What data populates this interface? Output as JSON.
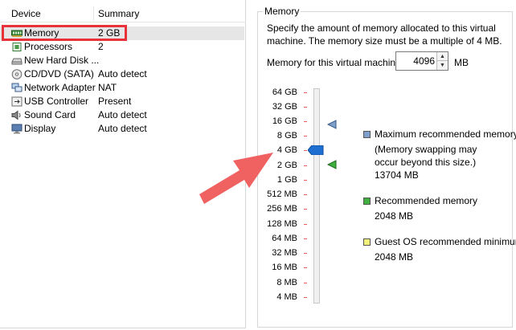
{
  "device_list": {
    "headers": {
      "device": "Device",
      "summary": "Summary"
    },
    "rows": [
      {
        "icon": "memory-chip-icon",
        "name": "Memory",
        "summary": "2 GB",
        "selected": true
      },
      {
        "icon": "processor-icon",
        "name": "Processors",
        "summary": "2"
      },
      {
        "icon": "hard-disk-icon",
        "name": "New Hard Disk ...",
        "summary": ""
      },
      {
        "icon": "cd-dvd-icon",
        "name": "CD/DVD (SATA)",
        "summary": "Auto detect"
      },
      {
        "icon": "network-adapter-icon",
        "name": "Network Adapter",
        "summary": "NAT"
      },
      {
        "icon": "usb-controller-icon",
        "name": "USB Controller",
        "summary": "Present"
      },
      {
        "icon": "sound-card-icon",
        "name": "Sound Card",
        "summary": "Auto detect"
      },
      {
        "icon": "display-icon",
        "name": "Display",
        "summary": "Auto detect"
      }
    ]
  },
  "memory_panel": {
    "group_title": "Memory",
    "description": "Specify the amount of memory allocated to this virtual machine. The memory size must be a multiple of 4 MB.",
    "input_label": "Memory for this virtual machine:",
    "input_value": "4096",
    "input_unit": "MB",
    "slider": {
      "ticks": [
        "64 GB",
        "32 GB",
        "16 GB",
        "8 GB",
        "4 GB",
        "2 GB",
        "1 GB",
        "512 MB",
        "256 MB",
        "128 MB",
        "64 MB",
        "32 MB",
        "16 MB",
        "8 MB",
        "4 MB"
      ],
      "current_value_tick_index": 4,
      "max_recommended_tick_index": 2.7,
      "recommended_tick_index": 5.0
    },
    "legend": {
      "max": {
        "label": "Maximum recommended memory",
        "note": "(Memory swapping may occur beyond this size.)",
        "value": "13704 MB",
        "color": "#7e9fc9"
      },
      "recommended": {
        "label": "Recommended memory",
        "value": "2048 MB",
        "color": "#3fb03f"
      },
      "guest": {
        "label": "Guest OS recommended minimum",
        "value": "2048 MB",
        "color": "#f2f27a"
      }
    }
  },
  "colors": {
    "highlight": "#e8323a",
    "arrow": "#f06262",
    "thumb": "#1f6fd0"
  }
}
